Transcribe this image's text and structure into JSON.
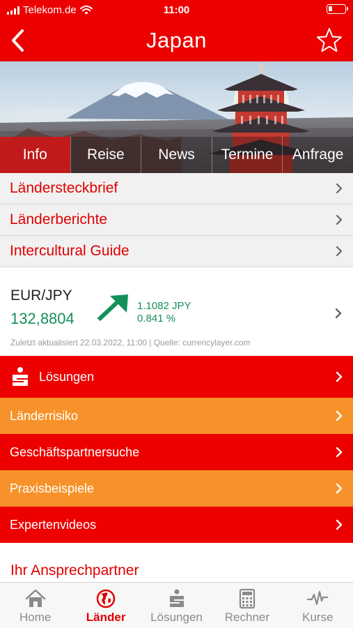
{
  "status_bar": {
    "carrier": "Telekom.de",
    "time": "11:00"
  },
  "header": {
    "title": "Japan"
  },
  "tabs": [
    {
      "label": "Info"
    },
    {
      "label": "Reise"
    },
    {
      "label": "News"
    },
    {
      "label": "Termine"
    },
    {
      "label": "Anfrage"
    }
  ],
  "menu": [
    {
      "label": "Ländersteckbrief"
    },
    {
      "label": "Länderberichte"
    },
    {
      "label": "Intercultural Guide"
    }
  ],
  "fx": {
    "pair": "EUR/JPY",
    "rate": "132,8804",
    "change_abs": "1.1082 JPY",
    "change_pct": "0.841 %",
    "meta": "Zuletzt aktualisiert  22.03.2022, 11:00 | Quelle: currencylayer.com"
  },
  "actions": [
    {
      "label": "Lösungen",
      "color": "red"
    },
    {
      "label": "Länderrisiko",
      "color": "orange"
    },
    {
      "label": "Geschäftspartnersuche",
      "color": "red"
    },
    {
      "label": "Praxisbeispiele",
      "color": "orange"
    },
    {
      "label": "Expertenvideos",
      "color": "red"
    }
  ],
  "contact_heading": "Ihr Ansprechpartner",
  "tabbar": [
    {
      "label": "Home",
      "icon": "home-icon"
    },
    {
      "label": "Länder",
      "icon": "globe-icon",
      "active": true
    },
    {
      "label": "Lösungen",
      "icon": "sparkasse-icon"
    },
    {
      "label": "Rechner",
      "icon": "calculator-icon"
    },
    {
      "label": "Kurse",
      "icon": "pulse-icon"
    }
  ],
  "colors": {
    "brand_red": "#ec0000",
    "orange": "#f7922a",
    "positive_green": "#14905a"
  }
}
